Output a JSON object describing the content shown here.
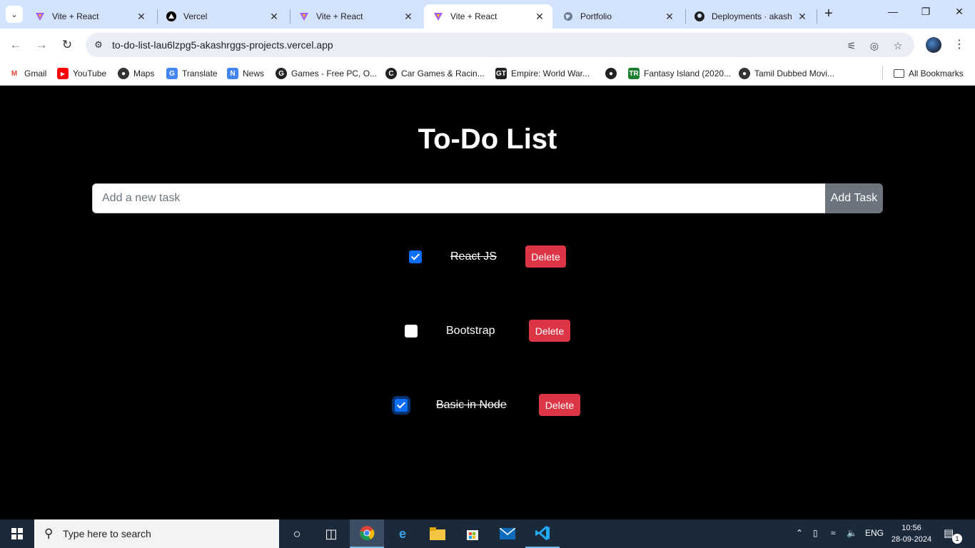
{
  "browser": {
    "tabs": [
      {
        "title": "Vite + React",
        "icon": "vite-icon",
        "active": false
      },
      {
        "title": "Vercel",
        "icon": "vercel-icon",
        "active": false
      },
      {
        "title": "Vite + React",
        "icon": "vite-icon",
        "active": false
      },
      {
        "title": "Vite + React",
        "icon": "vite-icon",
        "active": true
      },
      {
        "title": "Portfolio",
        "icon": "globe-icon",
        "active": false
      },
      {
        "title": "Deployments · akash",
        "icon": "github-icon",
        "active": false
      }
    ],
    "url": "to-do-list-lau6lzpg5-akashrggs-projects.vercel.app",
    "bookmarks": [
      {
        "label": "Gmail",
        "icon": "gmail-icon"
      },
      {
        "label": "YouTube",
        "icon": "youtube-icon"
      },
      {
        "label": "Maps",
        "icon": "maps-icon"
      },
      {
        "label": "Translate",
        "icon": "translate-icon"
      },
      {
        "label": "News",
        "icon": "news-icon"
      },
      {
        "label": "Games - Free PC, O...",
        "icon": "games-icon"
      },
      {
        "label": "Car Games & Racin...",
        "icon": "car-games-icon"
      },
      {
        "label": "Empire: World War...",
        "icon": "empire-icon"
      },
      {
        "label": "",
        "icon": "globe-icon"
      },
      {
        "label": "Fantasy Island (2020...",
        "icon": "fantasy-icon"
      },
      {
        "label": "Tamil Dubbed Movi...",
        "icon": "movie-icon"
      }
    ],
    "all_bookmarks": "All Bookmarks"
  },
  "app": {
    "title": "To-Do List",
    "input": {
      "placeholder": "Add a new task",
      "value": ""
    },
    "add_button": "Add Task",
    "delete_label": "Delete",
    "tasks": [
      {
        "text": "React JS",
        "completed": true
      },
      {
        "text": "Bootstrap",
        "completed": false
      },
      {
        "text": "Basic in Node",
        "completed": true
      }
    ]
  },
  "taskbar": {
    "search_placeholder": "Type here to search",
    "language": "ENG",
    "time": "10:56",
    "date": "28-09-2024",
    "notification_count": "1"
  }
}
